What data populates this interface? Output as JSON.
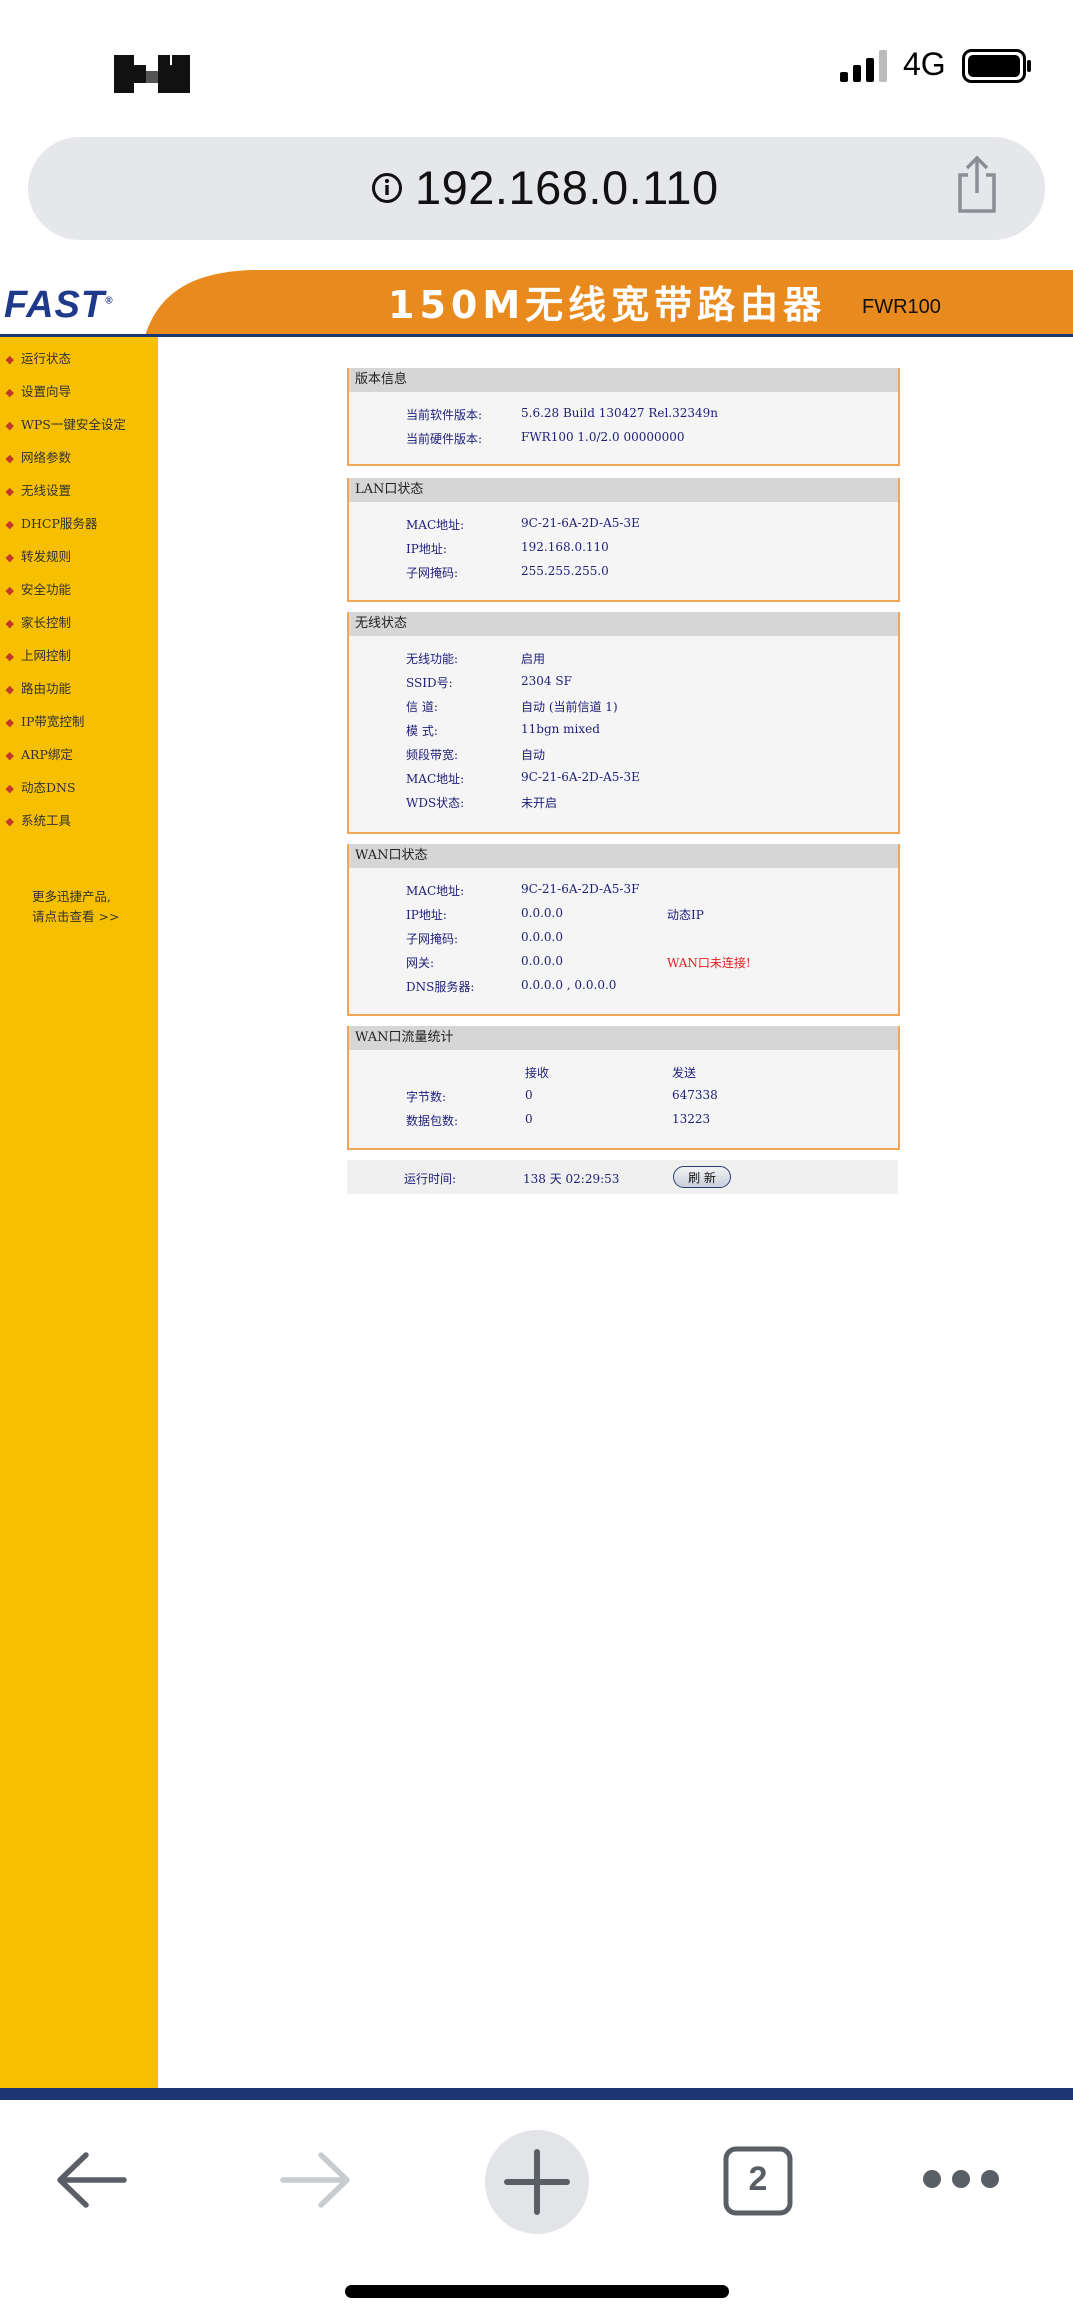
{
  "status_bar": {
    "network": "4G"
  },
  "address_bar": {
    "url": "192.168.0.110"
  },
  "router": {
    "brand": "FAST",
    "title": "150M无线宽带路由器",
    "model": "FWR100",
    "menu": [
      "运行状态",
      "设置向导",
      "WPS一键安全设定",
      "网络参数",
      "无线设置",
      "DHCP服务器",
      "转发规则",
      "安全功能",
      "家长控制",
      "上网控制",
      "路由功能",
      "IP带宽控制",
      "ARP绑定",
      "动态DNS",
      "系统工具"
    ],
    "more_link": {
      "line1": "更多迅捷产品,",
      "line2": "请点击查看 >>"
    },
    "version": {
      "title": "版本信息",
      "rows": [
        {
          "label": "当前软件版本:",
          "value": "5.6.28 Build 130427 Rel.32349n"
        },
        {
          "label": "当前硬件版本:",
          "value": "FWR100 1.0/2.0 00000000"
        }
      ]
    },
    "lan": {
      "title": "LAN口状态",
      "rows": [
        {
          "label": "MAC地址:",
          "value": "9C-21-6A-2D-A5-3E"
        },
        {
          "label": "IP地址:",
          "value": "192.168.0.110"
        },
        {
          "label": "子网掩码:",
          "value": "255.255.255.0"
        }
      ]
    },
    "wireless": {
      "title": "无线状态",
      "rows": [
        {
          "label": "无线功能:",
          "value": "启用"
        },
        {
          "label": "SSID号:",
          "value": "2304 SF"
        },
        {
          "label": "信 道:",
          "value": "自动 (当前信道 1)"
        },
        {
          "label": "模 式:",
          "value": "11bgn mixed"
        },
        {
          "label": "频段带宽:",
          "value": "自动"
        },
        {
          "label": "MAC地址:",
          "value": "9C-21-6A-2D-A5-3E"
        },
        {
          "label": "WDS状态:",
          "value": "未开启"
        }
      ]
    },
    "wan": {
      "title": "WAN口状态",
      "rows": [
        {
          "label": "MAC地址:",
          "value": "9C-21-6A-2D-A5-3F",
          "extra": ""
        },
        {
          "label": "IP地址:",
          "value": "0.0.0.0",
          "extra": "动态IP"
        },
        {
          "label": "子网掩码:",
          "value": "0.0.0.0",
          "extra": ""
        },
        {
          "label": "网关:",
          "value": "0.0.0.0",
          "extra": "WAN口未连接!"
        },
        {
          "label": "DNS服务器:",
          "value": "0.0.0.0 , 0.0.0.0",
          "extra": ""
        }
      ]
    },
    "traffic": {
      "title": "WAN口流量统计",
      "header": {
        "recv": "接收",
        "send": "发送"
      },
      "rows": [
        {
          "label": "字节数:",
          "recv": "0",
          "send": "647338"
        },
        {
          "label": "数据包数:",
          "recv": "0",
          "send": "13223"
        }
      ]
    },
    "uptime": {
      "label": "运行时间:",
      "value": "138 天 02:29:53",
      "refresh": "刷 新"
    }
  },
  "toolbar": {
    "tab_count": "2"
  },
  "colors": {
    "sidebar": "#f6bf00",
    "header_orange": "#e98a1e",
    "navy": "#1d3774",
    "alert": "#e02020"
  },
  "icons": [
    "info-icon",
    "share-icon",
    "back-icon",
    "forward-icon",
    "new-tab-icon",
    "tabs-icon",
    "more-icon",
    "signal-icon",
    "battery-icon"
  ]
}
